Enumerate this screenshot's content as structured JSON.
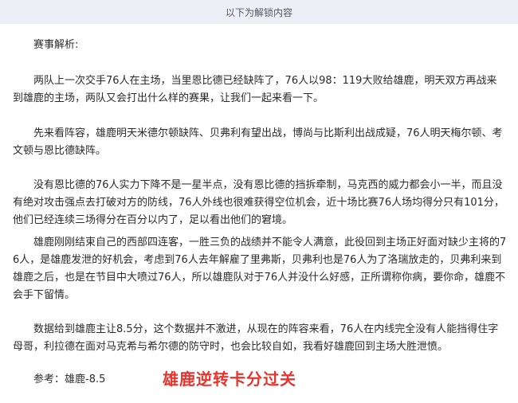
{
  "banner": {
    "text": "以下为解锁内容"
  },
  "article": {
    "heading": "赛事解析:",
    "paragraphs": [
      "两队上一次交手76人在主场，当里恩比德已经缺阵了，76人以98：119大败给雄鹿，明天双方再战来到雄鹿的主场，两队又会打出什么样的赛果，让我们一起来看一下。",
      "先来看阵容，雄鹿明天米德尔顿缺阵、贝弗利有望出战，博尚与比斯利出战成疑，76人明天梅尔顿、考文顿与恩比德缺阵。",
      "没有恩比德的76人实力下降不是一星半点，没有恩比德的挡拆牵制，马克西的威力都会小一半，而且没有绝对攻击强点去打破对方的防线，76人外线也很难获得空位机会，近十场比赛76人场均得分只有101分，他们已经连续三场得分在百分以内了，足以看出他们的窘境。",
      "雄鹿刚刚结束自己的西部四连客，一胜三负的战绩并不能令人满意，此役回到主场正好面对缺少主将的76人，是雄鹿发泄的好机会，考虑到76人去年解雇了里弗斯，贝弗利也是76人为了洛瑞放走的，贝弗利来到雄鹿之后，也是在节目中大喷过76人，所以雄鹿队对于76人并没什么好感，正所谓称你病，要你命，雄鹿不会手下留情。",
      "数据给到雄鹿主让8.5分，这个数据并不激进，从现在的阵容来看，76人在内线完全没有人能挡得住字母哥，利拉德在面对马克希与希尔德的防守时，也会比较自如，我看好雄鹿回到主场大胜泄愤。"
    ],
    "reference": "参考：雄鹿-8.5",
    "verdict": "雄鹿逆转卡分过关"
  },
  "colors": {
    "banner_bg": "#eeeef6",
    "body_text": "#2b2b2b",
    "verdict": "#e8342e"
  }
}
